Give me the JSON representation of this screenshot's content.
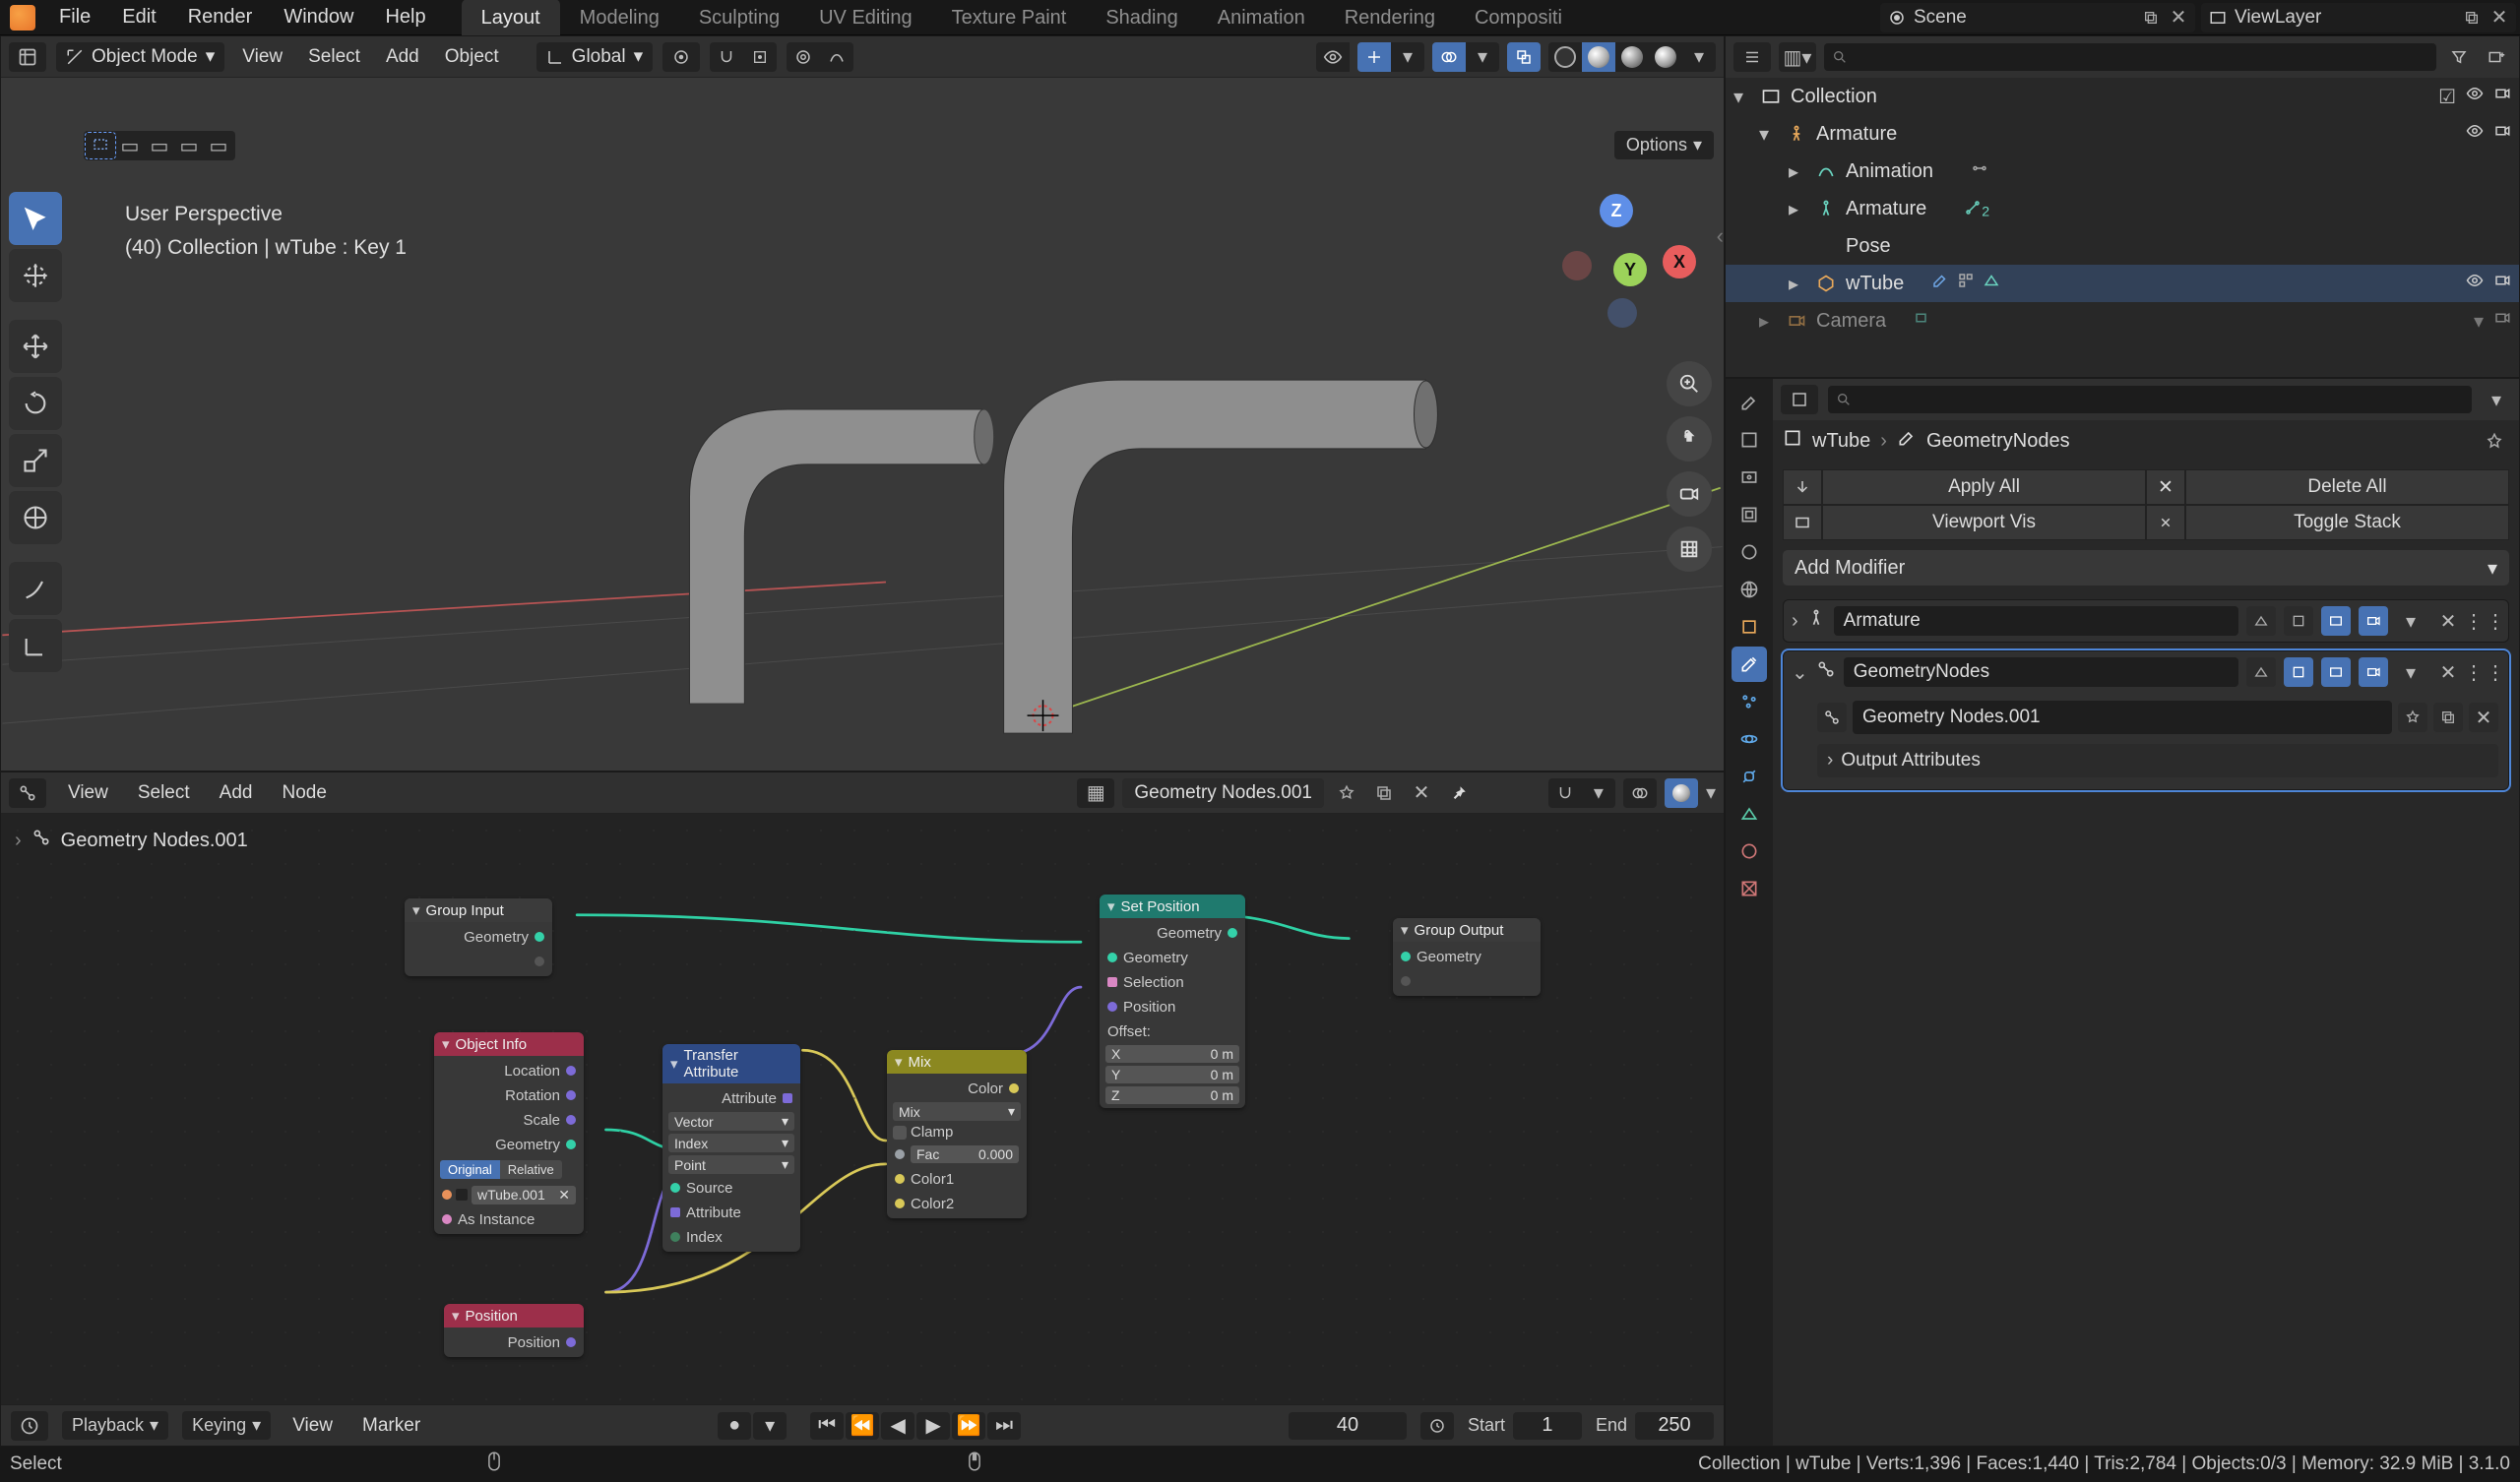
{
  "app": {
    "name": "Blender"
  },
  "topmenu": {
    "file": "File",
    "edit": "Edit",
    "render": "Render",
    "window": "Window",
    "help": "Help"
  },
  "workspaces": [
    "Layout",
    "Modeling",
    "Sculpting",
    "UV Editing",
    "Texture Paint",
    "Shading",
    "Animation",
    "Rendering",
    "Compositing"
  ],
  "workspace_active": 0,
  "scene": {
    "label": "Scene"
  },
  "viewlayer": {
    "label": "ViewLayer"
  },
  "viewport": {
    "mode": "Object Mode",
    "menus": {
      "view": "View",
      "select": "Select",
      "add": "Add",
      "object": "Object"
    },
    "orientation": "Global",
    "options": "Options",
    "info_line1": "User Perspective",
    "info_line2": "(40) Collection | wTube : Key 1"
  },
  "timeline": {
    "playback": "Playback",
    "keying": "Keying",
    "view": "View",
    "marker": "Marker",
    "current_frame": "40",
    "start_label": "Start",
    "start": "1",
    "end_label": "End",
    "end": "250"
  },
  "node_editor": {
    "menus": {
      "view": "View",
      "select": "Select",
      "add": "Add",
      "node": "Node"
    },
    "tree_name": "Geometry Nodes.001",
    "breadcrumb": "Geometry Nodes.001",
    "nodes": {
      "group_input": {
        "title": "Group Input",
        "out_geometry": "Geometry"
      },
      "object_info": {
        "title": "Object Info",
        "out_location": "Location",
        "out_rotation": "Rotation",
        "out_scale": "Scale",
        "out_geometry": "Geometry",
        "toggle_original": "Original",
        "toggle_relative": "Relative",
        "object_field": "wTube.001",
        "as_instance": "As Instance"
      },
      "position": {
        "title": "Position",
        "out_position": "Position"
      },
      "transfer": {
        "title": "Transfer Attribute",
        "out_attribute": "Attribute",
        "type": "Vector",
        "mapping": "Index",
        "domain": "Point",
        "in_source": "Source",
        "in_attribute": "Attribute",
        "in_index": "Index"
      },
      "mix": {
        "title": "Mix",
        "out_color": "Color",
        "blend": "Mix",
        "clamp": "Clamp",
        "fac_label": "Fac",
        "fac_value": "0.000",
        "color1": "Color1",
        "color2": "Color2"
      },
      "set_position": {
        "title": "Set Position",
        "out_geometry": "Geometry",
        "in_geometry": "Geometry",
        "in_selection": "Selection",
        "in_position": "Position",
        "in_offset": "Offset:",
        "x": "X",
        "y": "Y",
        "z": "Z",
        "zero": "0 m"
      },
      "group_output": {
        "title": "Group Output",
        "in_geometry": "Geometry"
      }
    }
  },
  "outliner": {
    "collection": "Collection",
    "items": [
      {
        "name": "Armature",
        "icon": "armature"
      },
      {
        "name": "Animation",
        "icon": "anim"
      },
      {
        "name": "Armature",
        "icon": "armature-data"
      },
      {
        "name": "Pose",
        "icon": "pose"
      },
      {
        "name": "wTube",
        "icon": "mesh"
      },
      {
        "name": "Camera",
        "icon": "camera"
      }
    ],
    "armature_badge": "2"
  },
  "properties": {
    "object": "wTube",
    "modifier_crumb": "GeometryNodes",
    "apply_all": "Apply All",
    "delete_all": "Delete All",
    "viewport_vis": "Viewport Vis",
    "toggle_stack": "Toggle Stack",
    "add_modifier": "Add Modifier",
    "mod_armature": "Armature",
    "mod_geonodes": "GeometryNodes",
    "geo_tree": "Geometry Nodes.001",
    "output_attributes": "Output Attributes"
  },
  "statusbar": {
    "left": "Select",
    "right": "Collection | wTube | Verts:1,396 | Faces:1,440 | Tris:2,784 | Objects:0/3 | Memory: 32.9 MiB | 3.1.0"
  }
}
